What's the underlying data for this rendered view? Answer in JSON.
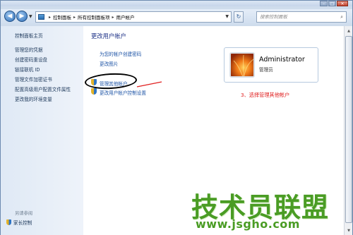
{
  "window": {
    "controls": {
      "minimize": "–",
      "maximize": "□",
      "close": "✕"
    }
  },
  "address_bar": {
    "back_icon": "back-arrow-icon",
    "forward_icon": "forward-arrow-icon",
    "crumbs": [
      "控制面板",
      "所有控制面板项",
      "用户帐户"
    ],
    "search_placeholder": "搜索控制面板"
  },
  "sidebar": {
    "home": "控制面板主页",
    "links": [
      "管理您的凭据",
      "创建密码重设盘",
      "链接联机 ID",
      "管理文件加密证书",
      "配置高级用户配置文件属性",
      "更改我的环境变量"
    ],
    "see_also": "另请参阅",
    "family_safety": "家长控制"
  },
  "main": {
    "heading": "更改用户帐户",
    "tasks": [
      "为您的帐户创建密码",
      "更改图片",
      "管理其他帐户",
      "更改用户帐户控制设置"
    ],
    "annotation": "3、选择管理其他帐户"
  },
  "account": {
    "name": "Administrator",
    "role": "管理员"
  },
  "watermark": {
    "text": "技术员联盟",
    "url": "www.jsgho.com"
  }
}
